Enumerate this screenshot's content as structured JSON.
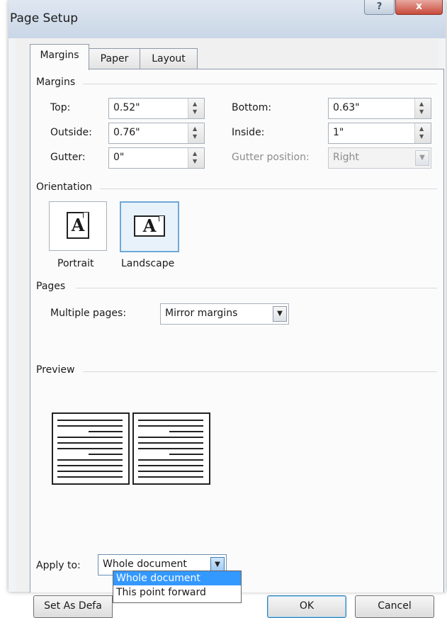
{
  "window": {
    "title": "Page Setup",
    "help_label": "?",
    "close_label": "x"
  },
  "tabs": [
    {
      "label": "Margins",
      "active": true
    },
    {
      "label": "Paper",
      "active": false
    },
    {
      "label": "Layout",
      "active": false
    }
  ],
  "margins": {
    "group_label": "Margins",
    "top": {
      "label": "Top:",
      "value": "0.52\""
    },
    "bottom": {
      "label": "Bottom:",
      "value": "0.63\""
    },
    "outside": {
      "label": "Outside:",
      "value": "0.76\""
    },
    "inside": {
      "label": "Inside:",
      "value": "1\""
    },
    "gutter": {
      "label": "Gutter:",
      "value": "0\""
    },
    "gutter_position": {
      "label": "Gutter position:",
      "value": "Right",
      "disabled": true
    }
  },
  "orientation": {
    "group_label": "Orientation",
    "portrait": {
      "label": "Portrait",
      "icon_letter": "A",
      "selected": false
    },
    "landscape": {
      "label": "Landscape",
      "icon_letter": "A",
      "selected": true
    }
  },
  "pages": {
    "group_label": "Pages",
    "multiple_pages_label": "Multiple pages:",
    "multiple_pages_value": "Mirror margins"
  },
  "preview": {
    "group_label": "Preview"
  },
  "apply_to": {
    "label": "Apply to:",
    "value": "Whole document",
    "options": [
      "Whole document",
      "This point forward"
    ],
    "highlighted_option": "Whole document"
  },
  "buttons": {
    "set_as_default": "Set As Defa",
    "ok": "OK",
    "cancel": "Cancel"
  },
  "colors": {
    "highlight": "#3399ff",
    "selected_border": "#6fa8d8",
    "close_button": "#c84a3a"
  }
}
